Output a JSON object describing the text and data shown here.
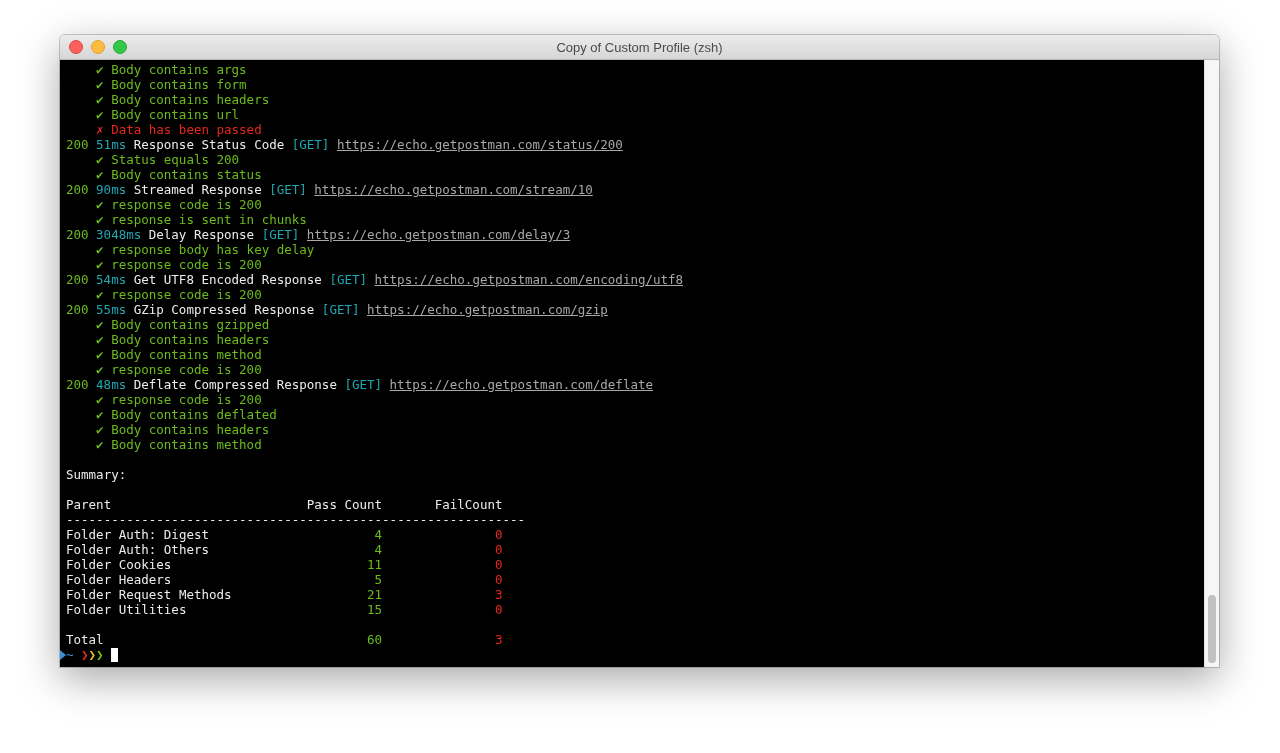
{
  "window": {
    "title": "Copy of Custom Profile (zsh)"
  },
  "lines": [
    {
      "kind": "check",
      "mark": "✔",
      "text": "Body contains args",
      "passed": true
    },
    {
      "kind": "check",
      "mark": "✔",
      "text": "Body contains form",
      "passed": true
    },
    {
      "kind": "check",
      "mark": "✔",
      "text": "Body contains headers",
      "passed": true
    },
    {
      "kind": "check",
      "mark": "✔",
      "text": "Body contains url",
      "passed": true
    },
    {
      "kind": "check",
      "mark": "✗",
      "text": "Data has been passed",
      "passed": false
    },
    {
      "kind": "request",
      "status": "200",
      "time": "51ms",
      "name": "Response Status Code",
      "method": "[GET]",
      "url": "https://echo.getpostman.com/status/200"
    },
    {
      "kind": "check",
      "mark": "✔",
      "text": "Status equals 200",
      "passed": true
    },
    {
      "kind": "check",
      "mark": "✔",
      "text": "Body contains status",
      "passed": true
    },
    {
      "kind": "request",
      "status": "200",
      "time": "90ms",
      "name": "Streamed Response",
      "method": "[GET]",
      "url": "https://echo.getpostman.com/stream/10"
    },
    {
      "kind": "check",
      "mark": "✔",
      "text": "response code is 200",
      "passed": true
    },
    {
      "kind": "check",
      "mark": "✔",
      "text": "response is sent in chunks",
      "passed": true
    },
    {
      "kind": "request",
      "status": "200",
      "time": "3048ms",
      "name": "Delay Response",
      "method": "[GET]",
      "url": "https://echo.getpostman.com/delay/3"
    },
    {
      "kind": "check",
      "mark": "✔",
      "text": "response body has key delay",
      "passed": true
    },
    {
      "kind": "check",
      "mark": "✔",
      "text": "response code is 200",
      "passed": true
    },
    {
      "kind": "request",
      "status": "200",
      "time": "54ms",
      "name": "Get UTF8 Encoded Response",
      "method": "[GET]",
      "url": "https://echo.getpostman.com/encoding/utf8"
    },
    {
      "kind": "check",
      "mark": "✔",
      "text": "response code is 200",
      "passed": true
    },
    {
      "kind": "request",
      "status": "200",
      "time": "55ms",
      "name": "GZip Compressed Response",
      "method": "[GET]",
      "url": "https://echo.getpostman.com/gzip"
    },
    {
      "kind": "check",
      "mark": "✔",
      "text": "Body contains gzipped",
      "passed": true
    },
    {
      "kind": "check",
      "mark": "✔",
      "text": "Body contains headers",
      "passed": true
    },
    {
      "kind": "check",
      "mark": "✔",
      "text": "Body contains method",
      "passed": true
    },
    {
      "kind": "check",
      "mark": "✔",
      "text": "response code is 200",
      "passed": true
    },
    {
      "kind": "request",
      "status": "200",
      "time": "48ms",
      "name": "Deflate Compressed Response",
      "method": "[GET]",
      "url": "https://echo.getpostman.com/deflate"
    },
    {
      "kind": "check",
      "mark": "✔",
      "text": "response code is 200",
      "passed": true
    },
    {
      "kind": "check",
      "mark": "✔",
      "text": "Body contains deflated",
      "passed": true
    },
    {
      "kind": "check",
      "mark": "✔",
      "text": "Body contains headers",
      "passed": true
    },
    {
      "kind": "check",
      "mark": "✔",
      "text": "Body contains method",
      "passed": true
    }
  ],
  "summary": {
    "title": "Summary:",
    "columns": [
      "Parent",
      "Pass Count",
      "FailCount"
    ],
    "rule": "-------------------------------------------------------------",
    "rows": [
      {
        "parent": "Folder Auth: Digest",
        "pass": "4",
        "fail": "0"
      },
      {
        "parent": "Folder Auth: Others",
        "pass": "4",
        "fail": "0"
      },
      {
        "parent": "Folder Cookies",
        "pass": "11",
        "fail": "0"
      },
      {
        "parent": "Folder Headers",
        "pass": "5",
        "fail": "0"
      },
      {
        "parent": "Folder Request Methods",
        "pass": "21",
        "fail": "3"
      },
      {
        "parent": "Folder Utilities",
        "pass": "15",
        "fail": "0"
      }
    ],
    "total": {
      "parent": "Total",
      "pass": "60",
      "fail": "3"
    }
  },
  "prompt": {
    "dir": "~",
    "symbols": [
      {
        "char": "❯",
        "color": "#e0301e"
      },
      {
        "char": "❯",
        "color": "#e8c21c"
      },
      {
        "char": "❯",
        "color": "#6cc417"
      }
    ]
  }
}
